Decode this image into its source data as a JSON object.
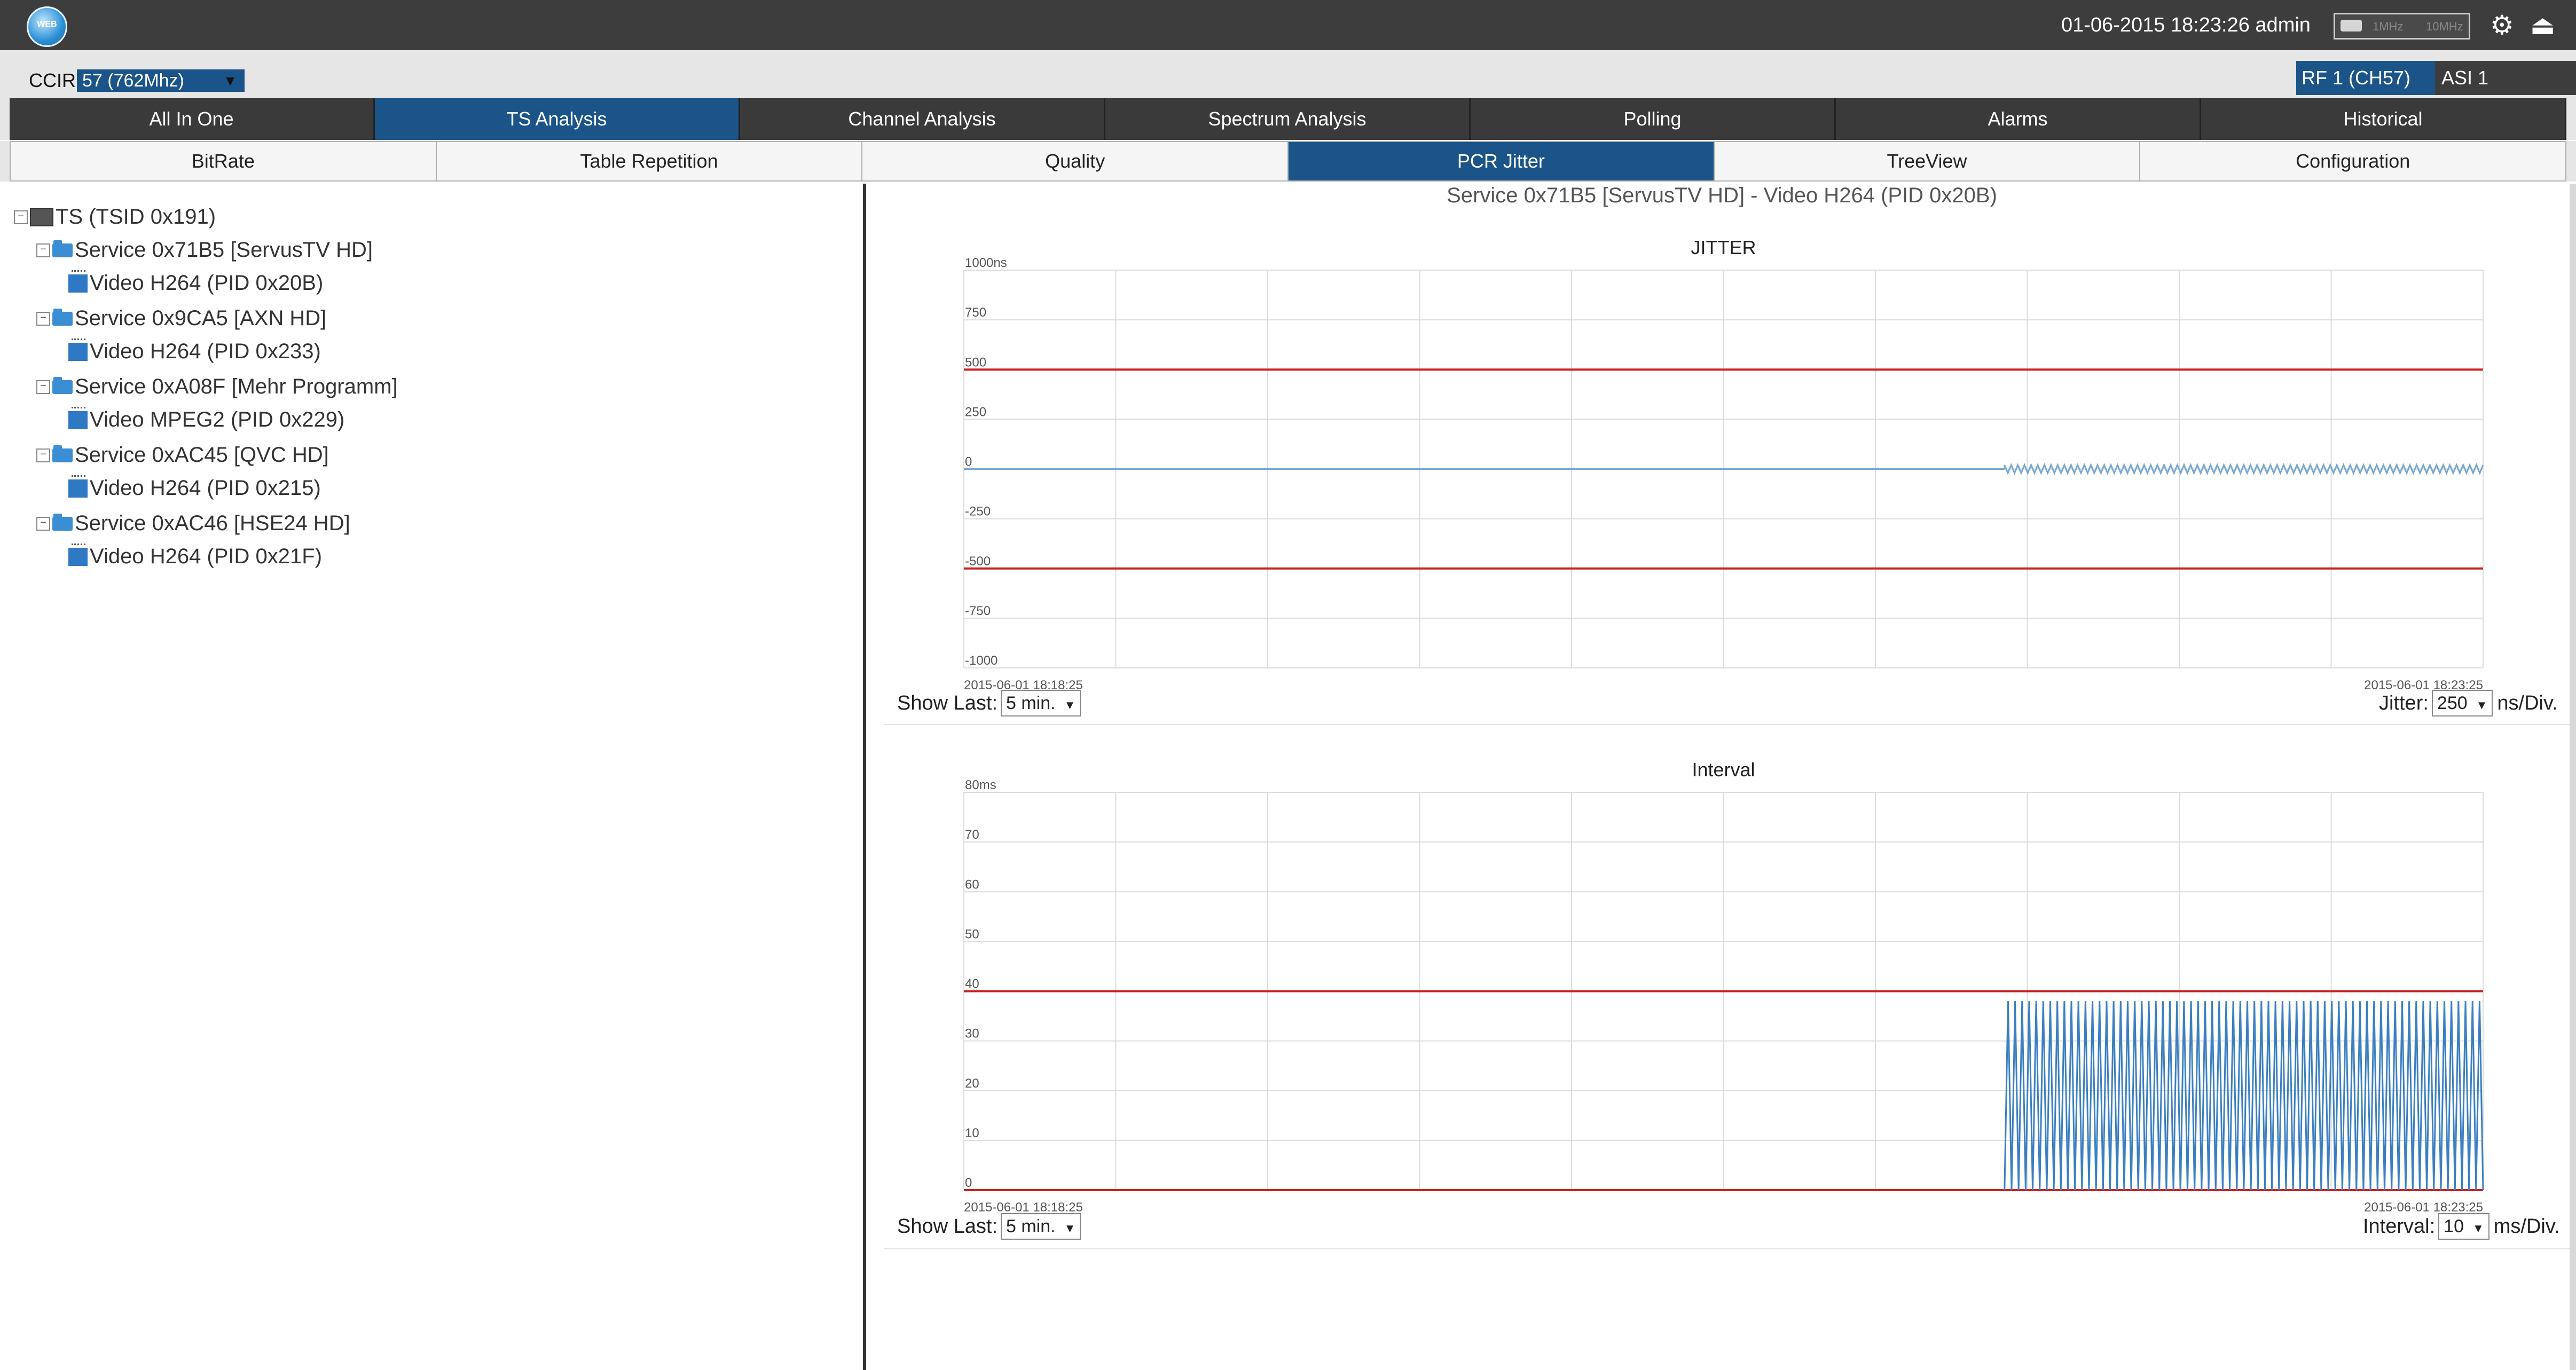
{
  "header": {
    "logo_text": "WEB",
    "datetime": "01-06-2015 18:23:26",
    "user": "admin",
    "meter_labels": [
      "1MHz",
      "10MHz"
    ],
    "icons": [
      "settings-gear-icon",
      "logout-icon"
    ]
  },
  "ccir": {
    "label": "CCIR",
    "selected": "57 (762Mhz)"
  },
  "inputs": {
    "rf": "RF 1 (CH57)",
    "asi": "ASI 1"
  },
  "main_tabs": [
    "All In One",
    "TS Analysis",
    "Channel Analysis",
    "Spectrum Analysis",
    "Polling",
    "Alarms",
    "Historical"
  ],
  "main_tabs_active": "TS Analysis",
  "sub_tabs": [
    "BitRate",
    "Table Repetition",
    "Quality",
    "PCR Jitter",
    "TreeView",
    "Configuration"
  ],
  "sub_tabs_active": "PCR Jitter",
  "tree": {
    "root": "TS (TSID 0x191)",
    "services": [
      {
        "label": "Service 0x71B5 [ServusTV HD]",
        "child": "Video H264 (PID 0x20B)"
      },
      {
        "label": "Service 0x9CA5 [AXN HD]",
        "child": "Video H264 (PID 0x233)"
      },
      {
        "label": "Service 0xA08F [Mehr Programm]",
        "child": "Video MPEG2 (PID 0x229)"
      },
      {
        "label": "Service 0xAC45 [QVC HD]",
        "child": "Video H264 (PID 0x215)"
      },
      {
        "label": "Service 0xAC46 [HSE24 HD]",
        "child": "Video H264 (PID 0x21F)"
      }
    ]
  },
  "chart_area": {
    "service_title": "Service 0x71B5 [ServusTV HD] - Video H264 (PID 0x20B)"
  },
  "jitter_controls": {
    "show_last_label": "Show Last:",
    "show_last_value": "5 min.",
    "scale_label": "Jitter:",
    "scale_value": "250",
    "scale_unit": "ns/Div."
  },
  "interval_controls": {
    "show_last_label": "Show Last:",
    "show_last_value": "5 min.",
    "scale_label": "Interval:",
    "scale_value": "10",
    "scale_unit": "ms/Div."
  },
  "chart_data": [
    {
      "type": "line",
      "title": "JITTER",
      "y_unit": "ns",
      "ylim": [
        -1000,
        1000
      ],
      "yticks": [
        "1000ns",
        "750",
        "500",
        "250",
        "0",
        "-250",
        "-500",
        "-750",
        "-1000"
      ],
      "x_start_label": "2015-06-01 18:18:25",
      "x_end_label": "2015-06-01 18:23:25",
      "limit_lines": [
        500,
        -500
      ],
      "grid": true,
      "series": [
        {
          "segments": [
            {
              "x_from": 0.0,
              "x_to": 0.685,
              "value": 0
            },
            {
              "x_from": 0.685,
              "x_to": 1.0,
              "oscillation_amplitude": 20,
              "cycles": 72
            }
          ],
          "color": "#7aa7cf"
        }
      ]
    },
    {
      "type": "line",
      "title": "Interval",
      "y_unit": "ms",
      "ylim": [
        0,
        80
      ],
      "yticks": [
        "80ms",
        "70",
        "60",
        "50",
        "40",
        "30",
        "20",
        "10",
        "0"
      ],
      "x_start_label": "2015-06-01 18:18:25",
      "x_end_label": "2015-06-01 18:23:25",
      "limit_lines": [
        40,
        0
      ],
      "grid": true,
      "series": [
        {
          "segments": [
            {
              "x_from": 0.685,
              "x_to": 1.0,
              "oscillation_min": 0,
              "oscillation_max": 38,
              "cycles": 68
            }
          ],
          "color": "#3b7fc1"
        }
      ]
    }
  ],
  "colors": {
    "accent": "#1a5488",
    "limit_line": "#cc2222",
    "grid": "#dcdcdc"
  }
}
